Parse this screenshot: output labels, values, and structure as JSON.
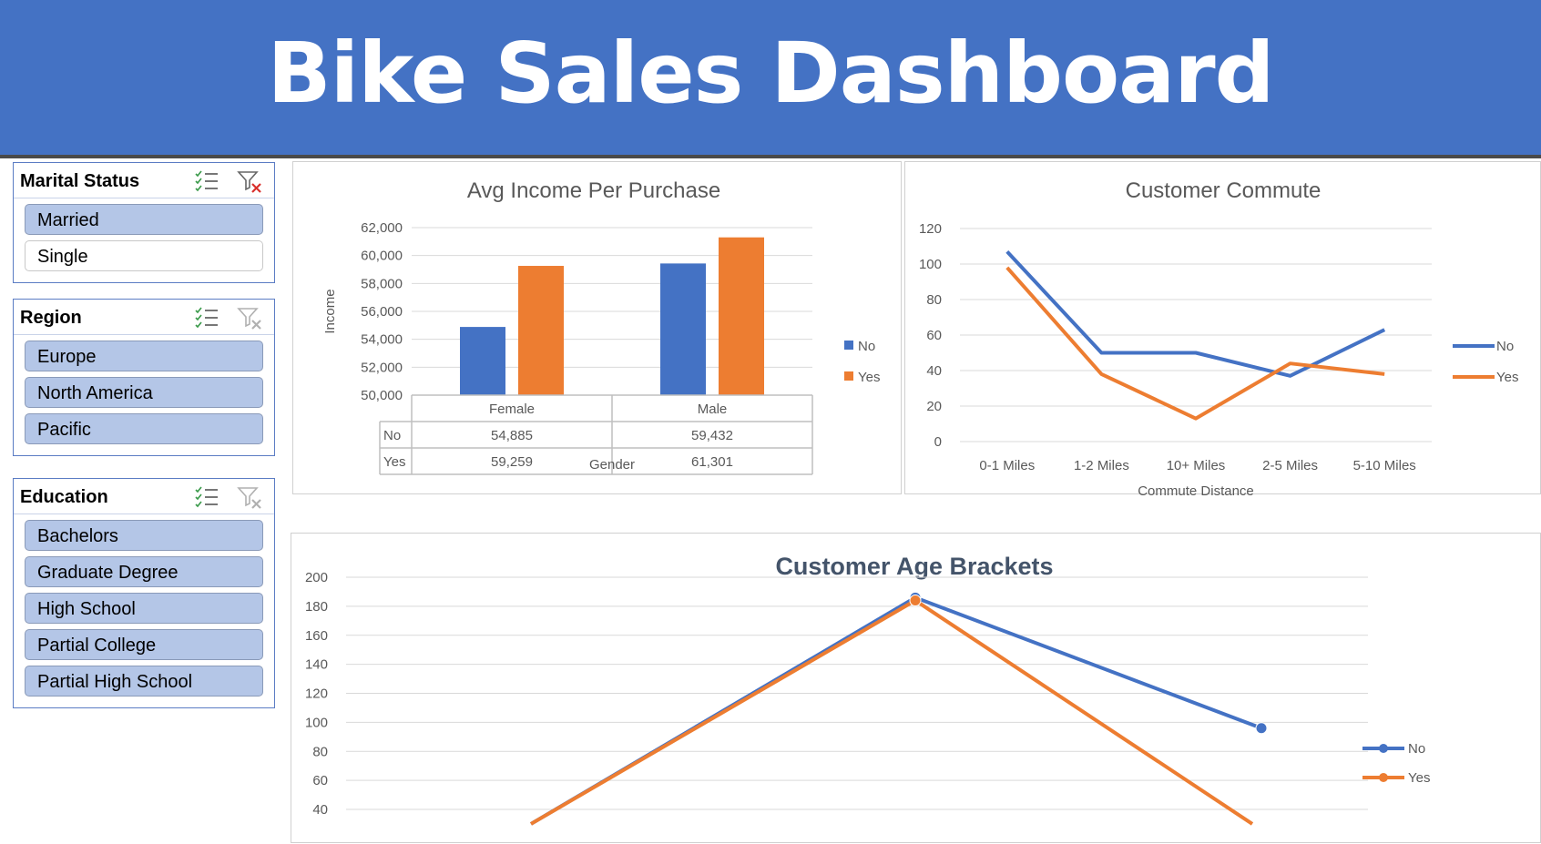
{
  "header": {
    "title": "Bike Sales Dashboard"
  },
  "slicers": [
    {
      "title": "Marital Status",
      "icons": [
        "multi-select-icon",
        "clear-filter-icon"
      ],
      "clear_active": true,
      "items": [
        {
          "label": "Married",
          "selected": true
        },
        {
          "label": "Single",
          "selected": false
        }
      ]
    },
    {
      "title": "Region",
      "icons": [
        "multi-select-icon",
        "clear-filter-icon"
      ],
      "clear_active": false,
      "items": [
        {
          "label": "Europe",
          "selected": true
        },
        {
          "label": "North America",
          "selected": true
        },
        {
          "label": "Pacific",
          "selected": true
        }
      ]
    },
    {
      "title": "Education",
      "icons": [
        "multi-select-icon",
        "clear-filter-icon"
      ],
      "clear_active": false,
      "items": [
        {
          "label": "Bachelors",
          "selected": true
        },
        {
          "label": "Graduate Degree",
          "selected": true
        },
        {
          "label": "High School",
          "selected": true
        },
        {
          "label": "Partial College",
          "selected": true
        },
        {
          "label": "Partial High School",
          "selected": true
        }
      ]
    }
  ],
  "colors": {
    "accent": "#4472c4",
    "no": "#4472c4",
    "yes": "#ed7d31",
    "grid": "#d9d9d9"
  },
  "chart_data": [
    {
      "type": "bar",
      "title": "Avg Income Per Purchase",
      "xlabel": "Gender",
      "ylabel": "Income",
      "categories": [
        "Female",
        "Male"
      ],
      "series": [
        {
          "name": "No",
          "values": [
            54885,
            59432
          ],
          "labels": [
            "54,885",
            "59,432"
          ]
        },
        {
          "name": "Yes",
          "values": [
            59259,
            61301
          ],
          "labels": [
            "59,259",
            "61,301"
          ]
        }
      ],
      "ylim": [
        50000,
        62000
      ],
      "yticks": [
        50000,
        52000,
        54000,
        56000,
        58000,
        60000,
        62000
      ],
      "ytick_labels": [
        "50,000",
        "52,000",
        "54,000",
        "56,000",
        "58,000",
        "60,000",
        "62,000"
      ],
      "data_table": true,
      "legend": "right",
      "grid": true
    },
    {
      "type": "line",
      "title": "Customer Commute",
      "xlabel": "Commute Distance",
      "ylabel": "",
      "categories": [
        "0-1 Miles",
        "1-2 Miles",
        "10+ Miles",
        "2-5 Miles",
        "5-10 Miles"
      ],
      "series": [
        {
          "name": "No",
          "values": [
            107,
            50,
            50,
            37,
            63
          ]
        },
        {
          "name": "Yes",
          "values": [
            98,
            38,
            13,
            44,
            38
          ]
        }
      ],
      "ylim": [
        0,
        120
      ],
      "yticks": [
        0,
        20,
        40,
        60,
        80,
        100,
        120
      ],
      "ytick_labels": [
        "0",
        "20",
        "40",
        "60",
        "80",
        "100",
        "120"
      ],
      "legend": "right",
      "grid": true
    },
    {
      "type": "line",
      "title": "Customer Age Brackets",
      "xlabel": "",
      "ylabel": "",
      "categories": [
        "",
        "",
        ""
      ],
      "series": [
        {
          "name": "No",
          "values": [
            null,
            186,
            96
          ],
          "markers": true
        },
        {
          "name": "Yes",
          "values": [
            null,
            184,
            null
          ],
          "markers": true
        }
      ],
      "visible_ticks": [
        40,
        60,
        80,
        100,
        120,
        140,
        160,
        180,
        200
      ],
      "ytick_labels": [
        "40",
        "60",
        "80",
        "100",
        "120",
        "140",
        "160",
        "180",
        "200"
      ],
      "legend": "right",
      "grid": true
    }
  ]
}
